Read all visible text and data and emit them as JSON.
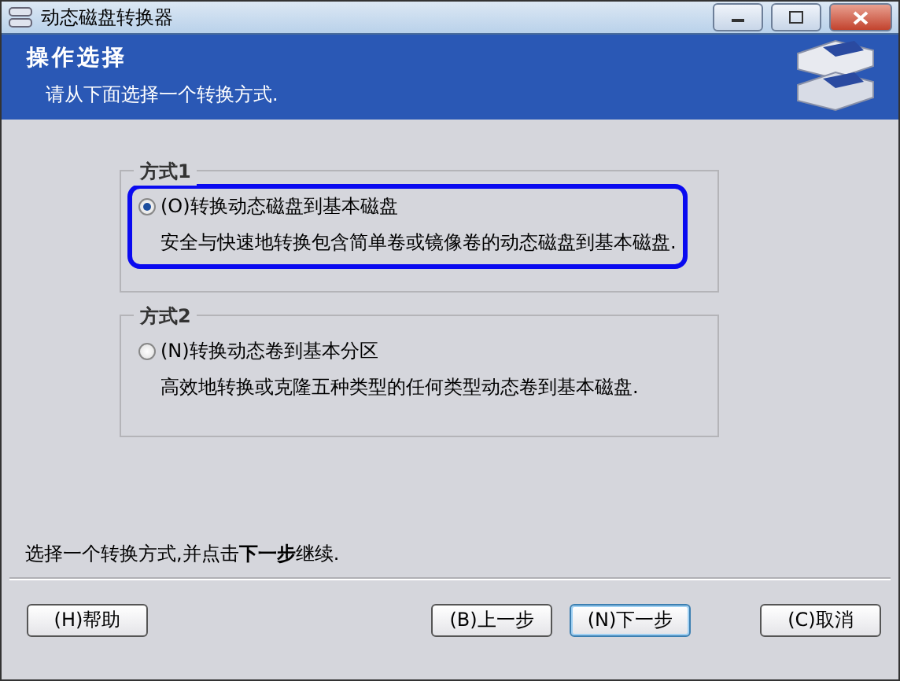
{
  "window": {
    "title": "动态磁盘转换器"
  },
  "header": {
    "title": "操作选择",
    "subtitle": "请从下面选择一个转换方式."
  },
  "options": [
    {
      "group": "方式1",
      "label": "(O)转换动态磁盘到基本磁盘",
      "description": "安全与快速地转换包含简单卷或镜像卷的动态磁盘到基本磁盘.",
      "selected": true
    },
    {
      "group": "方式2",
      "label": "(N)转换动态卷到基本分区",
      "description": "高效地转换或克隆五种类型的任何类型动态卷到基本磁盘.",
      "selected": false
    }
  ],
  "hint": "选择一个转换方式,并点击**下一步**继续.",
  "buttons": [
    {
      "label": "(H)帮助",
      "default": false
    },
    {
      "label": "(B)上一步",
      "default": false
    },
    {
      "label": "(N)下一步",
      "default": true
    },
    {
      "label": "(C)取消",
      "default": false
    }
  ]
}
